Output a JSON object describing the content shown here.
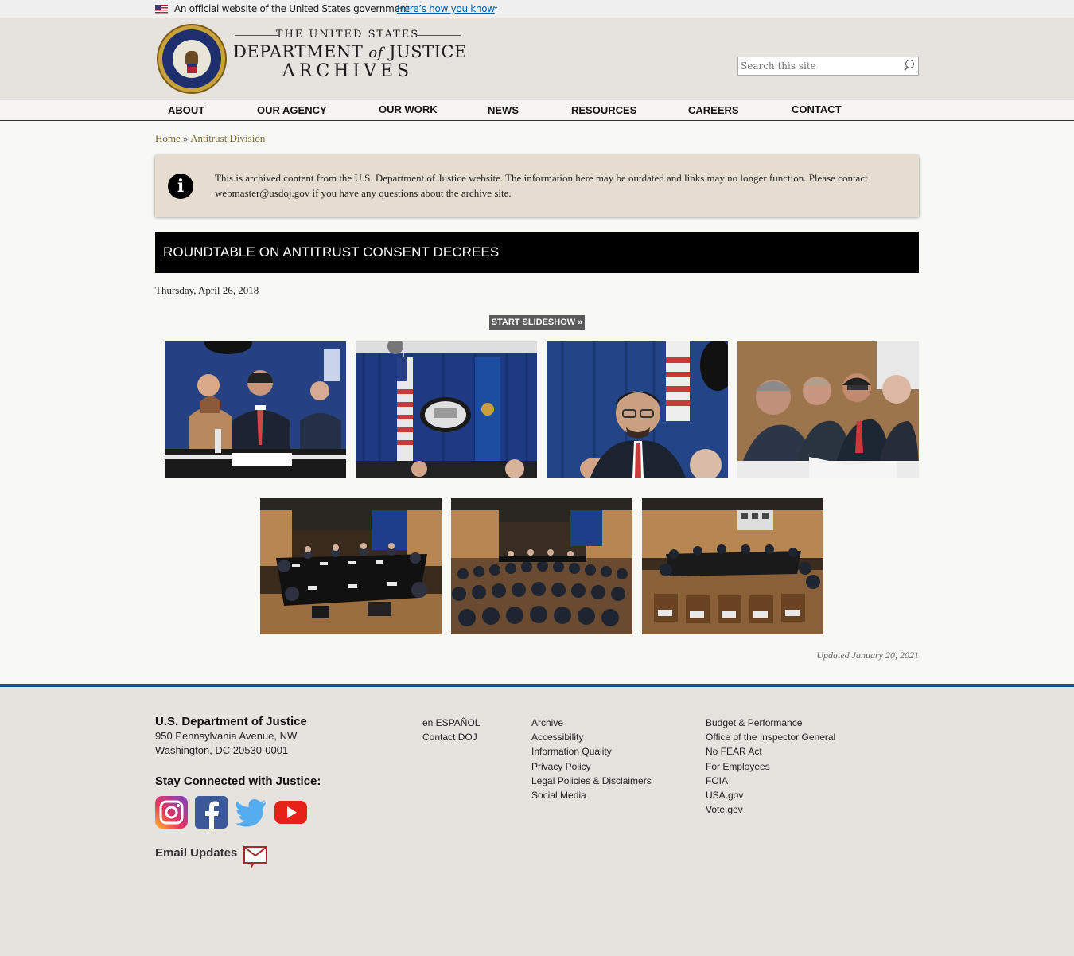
{
  "gov_banner": {
    "official_text": "An official website of the United States government",
    "link_text": "Here’s how you know"
  },
  "header": {
    "logo_line1": "THE UNITED STATES",
    "logo_line2_a": "DEPARTMENT",
    "logo_line2_of": "of",
    "logo_line2_b": "JUSTICE",
    "logo_line3": "ARCHIVES",
    "search_placeholder": "Search this site"
  },
  "nav": [
    {
      "label": "ABOUT"
    },
    {
      "label": "OUR AGENCY"
    },
    {
      "label": "OUR WORK"
    },
    {
      "label": "NEWS"
    },
    {
      "label": "RESOURCES"
    },
    {
      "label": "CAREERS"
    },
    {
      "label": "CONTACT"
    }
  ],
  "breadcrumb": {
    "home": "Home",
    "separator": "»",
    "current": "Antitrust Division"
  },
  "notice": {
    "icon": "info-icon",
    "text": "This is archived content from the U.S. Department of Justice website. The information here may be outdated and links may no longer function. Please contact webmaster@usdoj.gov if you have any questions about the archive site."
  },
  "page": {
    "title": "ROUNDTABLE ON ANTITRUST CONSENT DECREES",
    "date": "Thursday, April 26, 2018",
    "slideshow_label": "START SLIDESHOW »",
    "updated": "Updated January 20, 2021"
  },
  "footer": {
    "org": "U.S. Department of Justice",
    "address_line1": "950 Pennsylvania Avenue, NW",
    "address_line2": "Washington, DC 20530-0001",
    "stay_connected": "Stay Connected with Justice:",
    "social_icons": [
      "instagram-icon",
      "facebook-icon",
      "twitter-icon",
      "youtube-icon"
    ],
    "email_updates": "Email Updates",
    "col1": [
      "en ESPAÑOL",
      "Contact DOJ"
    ],
    "col2": [
      "Archive",
      "Accessibility",
      "Information Quality",
      "Privacy Policy",
      "Legal Policies & Disclaimers",
      "Social Media"
    ],
    "col3": [
      "Budget & Performance",
      "Office of the Inspector General",
      "No FEAR Act",
      "For Employees",
      "FOIA",
      "USA.gov",
      "Vote.gov"
    ]
  },
  "colors": {
    "title_bar": "#000000",
    "footer_rule": "#1f4f80",
    "link": "#7d6a35",
    "banner_link": "#005ea2"
  }
}
